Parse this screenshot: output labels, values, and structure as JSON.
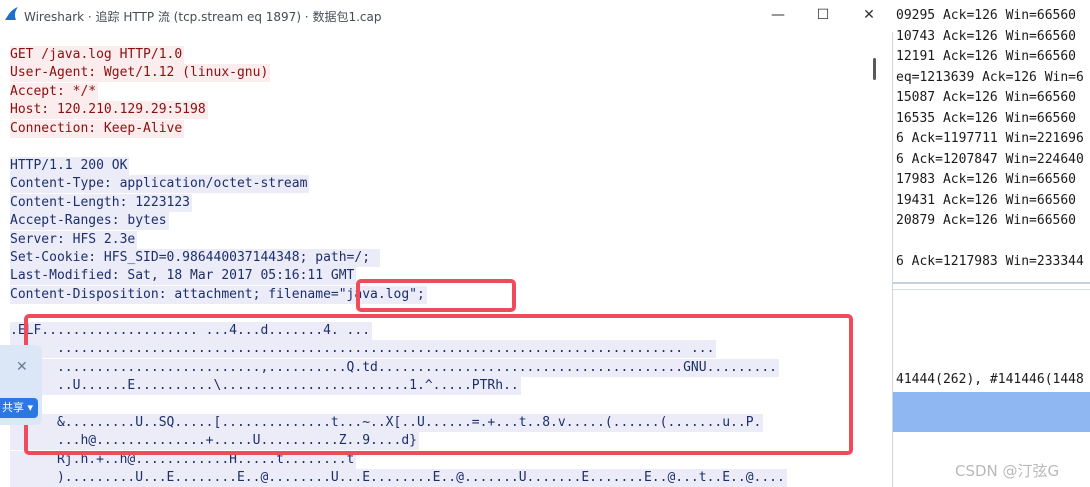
{
  "window": {
    "title": "Wireshark · 追踪 HTTP 流 (tcp.stream eq 1897) · 数据包1.cap",
    "minimize": "—",
    "maximize": "☐",
    "close": "✕"
  },
  "stream": {
    "request_lines": [
      "GET /java.log HTTP/1.0",
      "User-Agent: Wget/1.12 (linux-gnu)",
      "Accept: */*",
      "Host: 120.210.129.29:5198",
      "Connection: Keep-Alive"
    ],
    "response_lines": [
      "HTTP/1.1 200 OK",
      "Content-Type: application/octet-stream",
      "Content-Length: 1223123",
      "Accept-Ranges: bytes",
      "Server: HFS 2.3e",
      "Set-Cookie: HFS_SID=0.986440037144348; path=/; ",
      "Last-Modified: Sat, 18 Mar 2017 05:16:11 GMT",
      "Content-Disposition: attachment; filename=\"java.log\";"
    ],
    "binary_lines": [
      ".ELF.................... ...4...d.......4. ...",
      "      ................................................................................ ...",
      "      ..........................,..........Q.td.......................................GNU.........",
      "      ..U......E..........\\........................1.^.....PTRh..",
      "",
      "      &.........U..SQ.....[..............t...~..X[..U......=.+...t..8.v.....(......(.......u..P.",
      "      ...h@..............+.....U..........Z..9....d}",
      "      Rj.h.+..h@............H.....t........t",
      "      ).........U...E........E..@........U...E........E..@.......U.......E.......E..@...t..E..@...."
    ]
  },
  "background": {
    "packet_rows": [
      "09295 Ack=126 Win=66560",
      "10743 Ack=126 Win=66560",
      "12191 Ack=126 Win=66560",
      "eq=1213639 Ack=126 Win=6",
      "15087 Ack=126 Win=66560",
      "16535 Ack=126 Win=66560",
      "6 Ack=1197711 Win=221696",
      "6 Ack=1207847 Win=224640",
      "17983 Ack=126 Win=66560",
      "19431 Ack=126 Win=66560",
      "20879 Ack=126 Win=66560",
      "",
      "6 Ack=1217983 Win=233344"
    ],
    "detail_text": "41444(262), #141446(1448"
  },
  "float_widget": {
    "close": "✕",
    "share_label": "共享 ▾"
  },
  "watermark": "CSDN @汀弦G"
}
